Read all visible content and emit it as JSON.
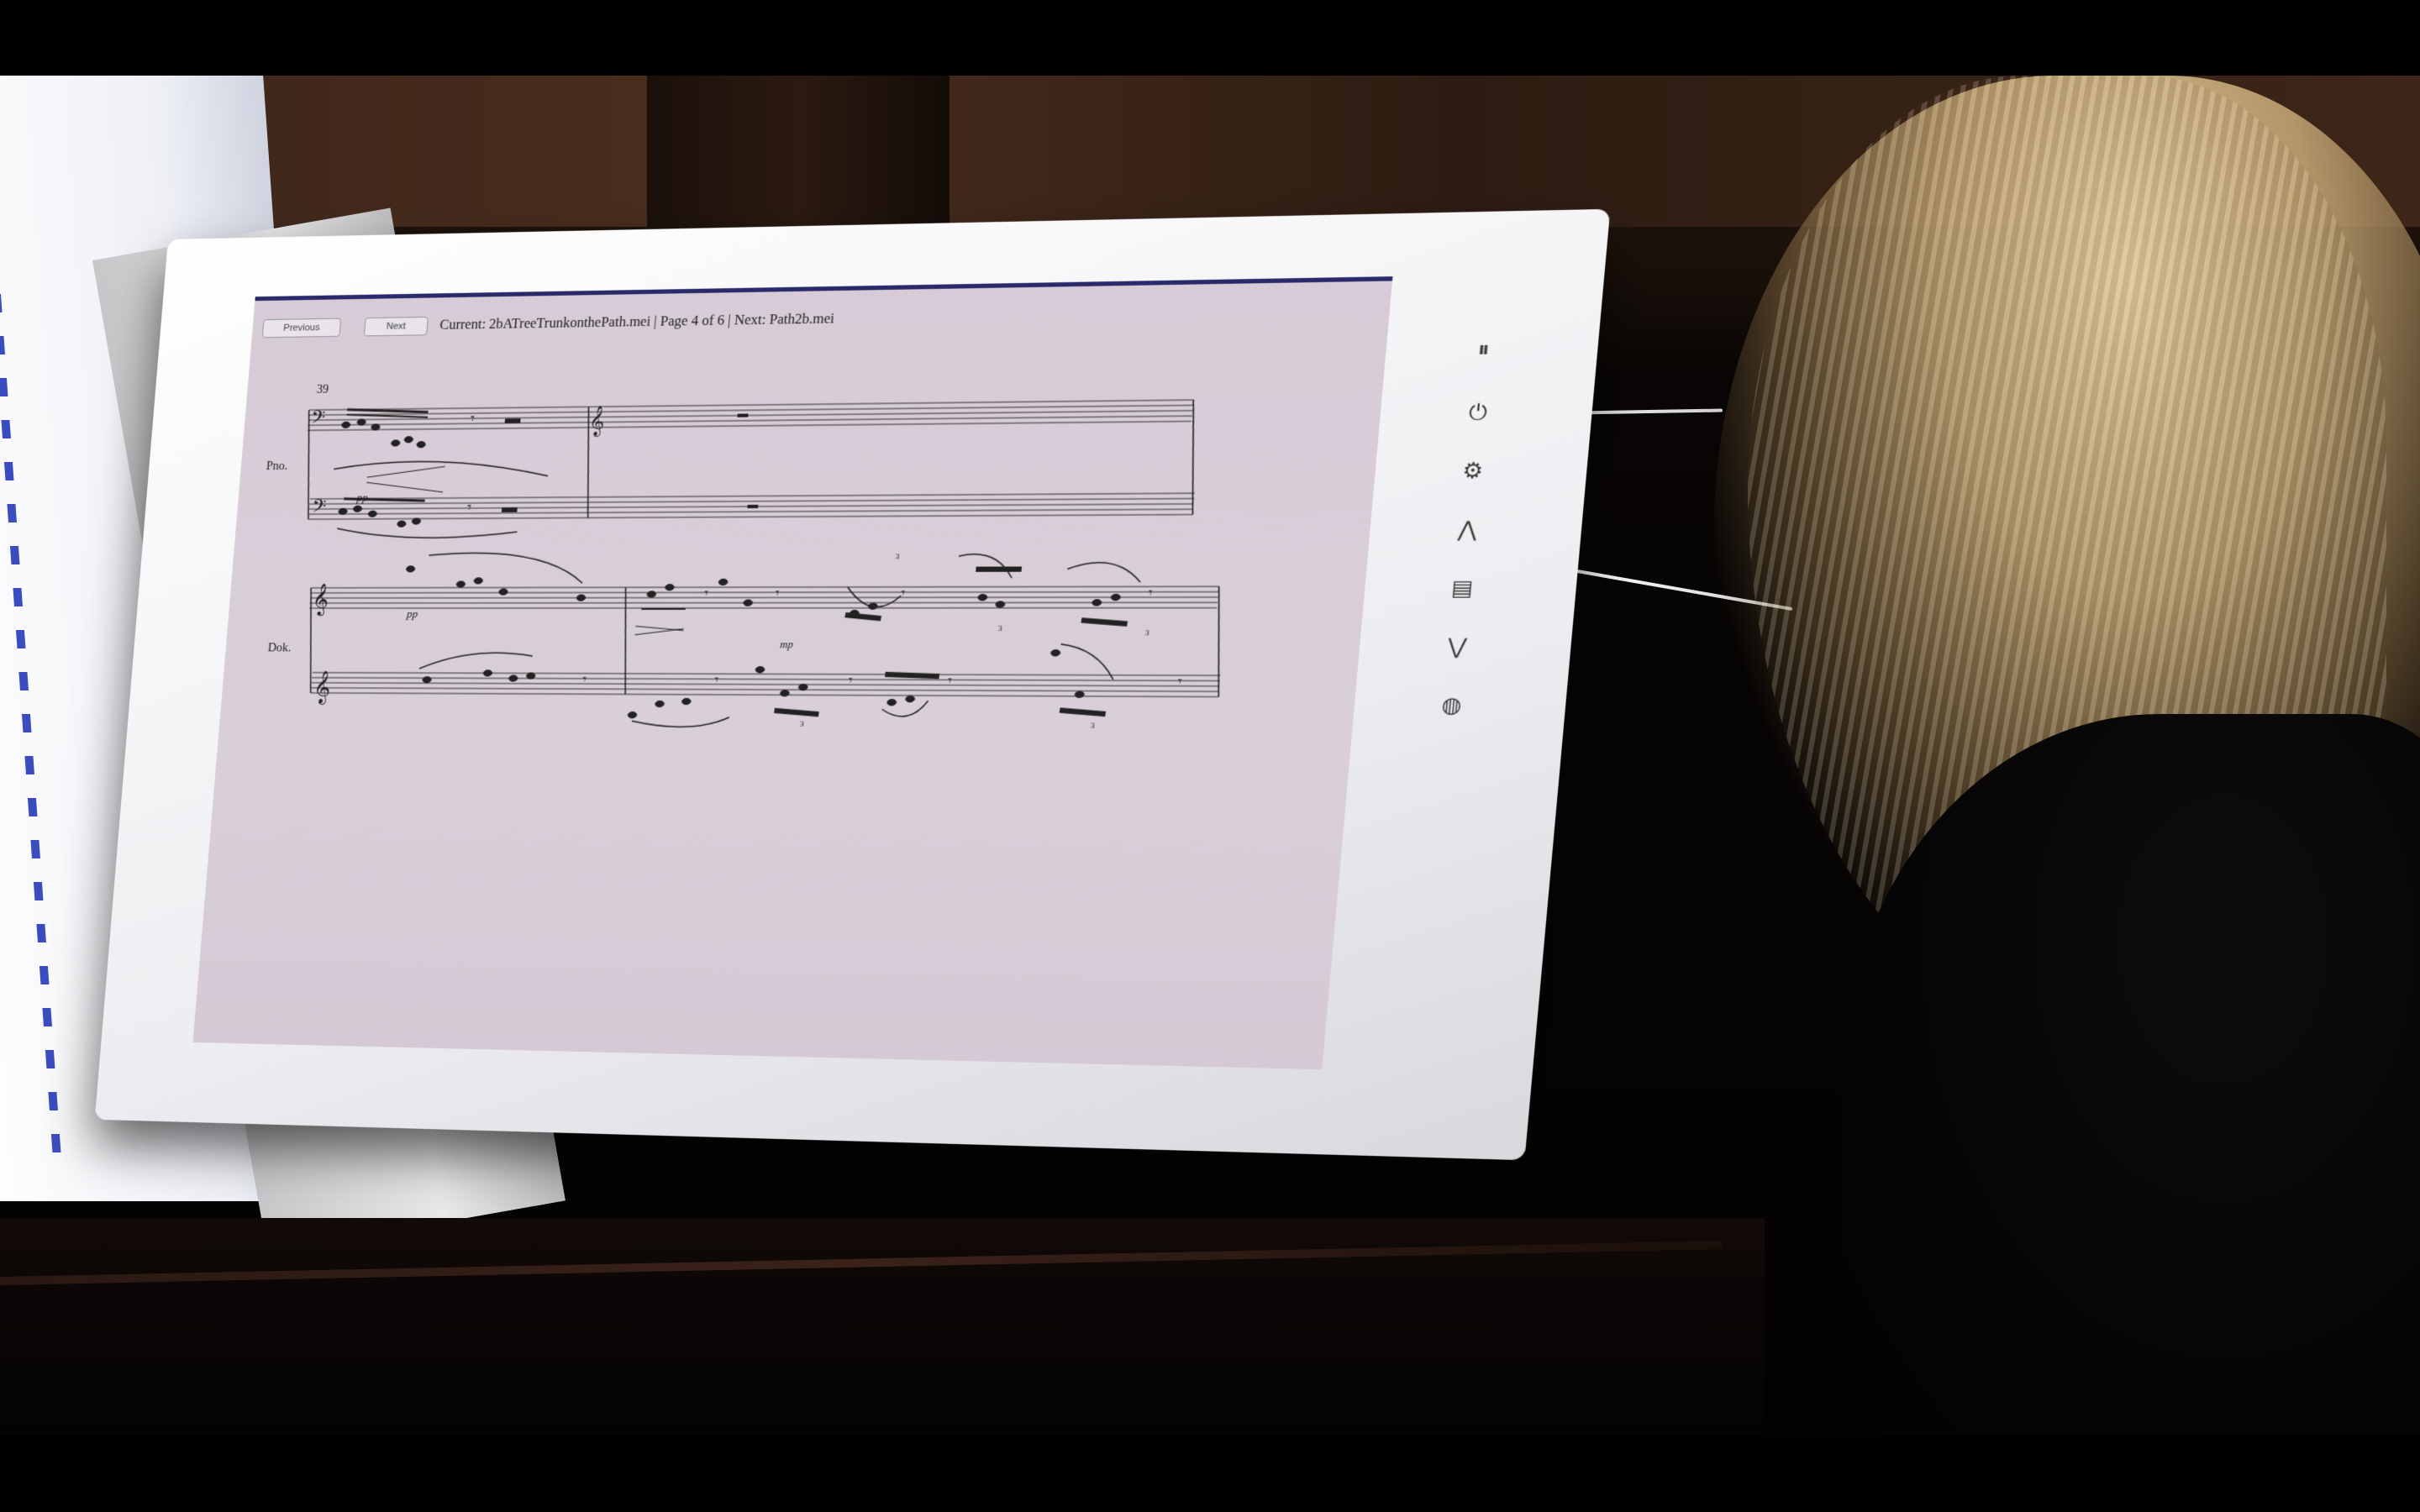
{
  "buttons": {
    "previous": "Previous",
    "next": "Next"
  },
  "status_line": "Current: 2bATreeTrunkonthePath.mei | Page 4 of 6 | Next: Path2b.mei",
  "score": {
    "measure_number": "39",
    "instrument_1": "Pno.",
    "instrument_2": "Dok.",
    "dynamics": [
      "pp",
      "pp",
      "mp"
    ],
    "tuplets": [
      "3",
      "3",
      "3",
      "3",
      "3"
    ]
  },
  "side_icons": [
    "pause-icon",
    "power-icon",
    "settings-icon",
    "up-icon",
    "page-icon",
    "down-icon",
    "globe-icon"
  ]
}
